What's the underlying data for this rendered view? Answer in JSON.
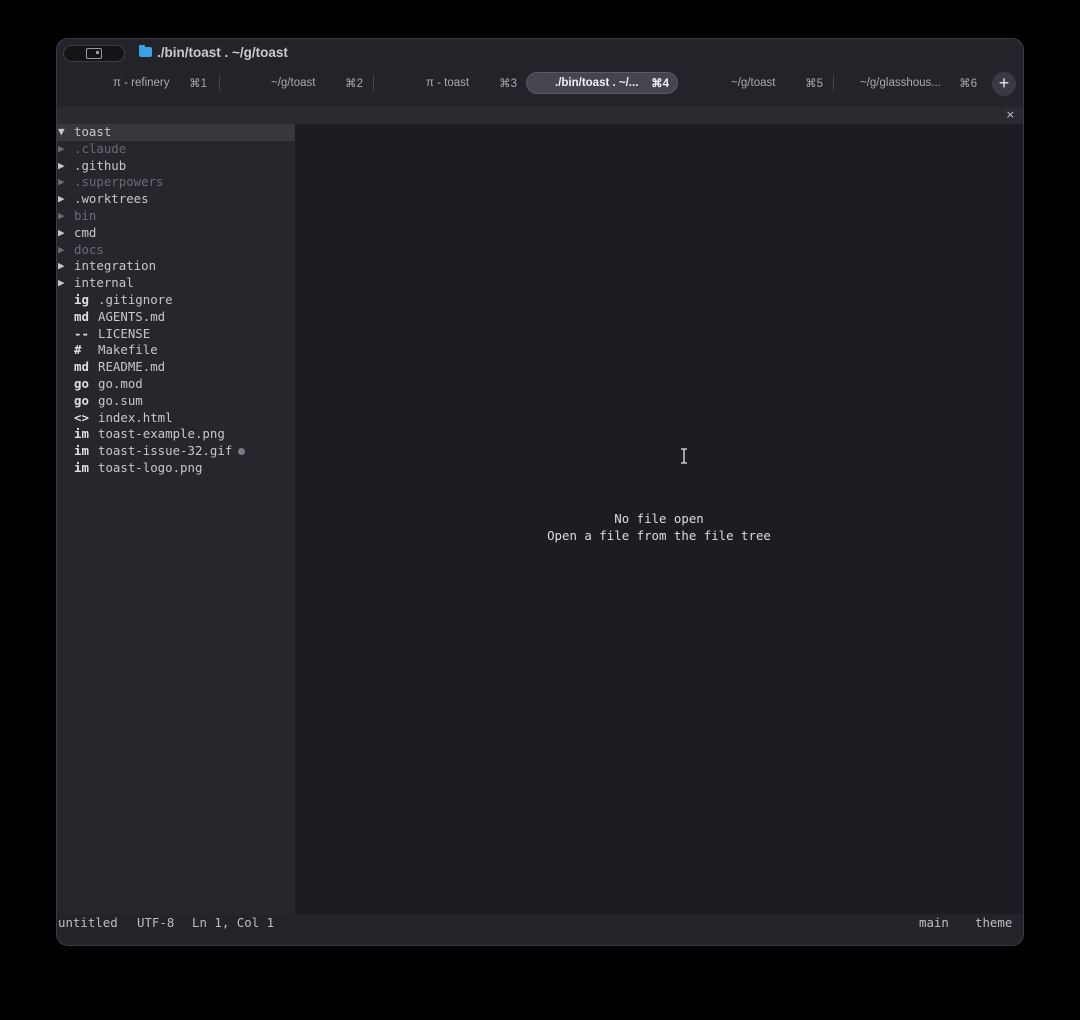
{
  "window": {
    "title": "./bin/toast . ~/g/toast"
  },
  "tabs": [
    {
      "label": "π - refinery",
      "shortcut": "⌘1"
    },
    {
      "label": "~/g/toast",
      "shortcut": "⌘2"
    },
    {
      "label": "π - toast",
      "shortcut": "⌘3"
    },
    {
      "label": "./bin/toast . ~/...",
      "shortcut": "⌘4",
      "active": true
    },
    {
      "label": "~/g/toast",
      "shortcut": "⌘5"
    },
    {
      "label": "~/g/glasshous...",
      "shortcut": "⌘6"
    }
  ],
  "new_tab_label": "+",
  "close_label": "×",
  "tree": {
    "root": {
      "arrow": "▼",
      "name": "toast"
    },
    "folders": [
      {
        "arrow": "▶",
        "name": ".claude",
        "dim": true
      },
      {
        "arrow": "▶",
        "name": ".github",
        "dim": false
      },
      {
        "arrow": "▶",
        "name": ".superpowers",
        "dim": true
      },
      {
        "arrow": "▶",
        "name": ".worktrees",
        "dim": false
      },
      {
        "arrow": "▶",
        "name": "bin",
        "dim": true
      },
      {
        "arrow": "▶",
        "name": "cmd",
        "dim": false
      },
      {
        "arrow": "▶",
        "name": "docs",
        "dim": true
      },
      {
        "arrow": "▶",
        "name": "integration",
        "dim": false
      },
      {
        "arrow": "▶",
        "name": "internal",
        "dim": false
      }
    ],
    "files": [
      {
        "type": "ig",
        "name": ".gitignore"
      },
      {
        "type": "md",
        "name": "AGENTS.md"
      },
      {
        "type": "--",
        "name": "LICENSE"
      },
      {
        "type": "#",
        "name": "Makefile"
      },
      {
        "type": "md",
        "name": "README.md"
      },
      {
        "type": "go",
        "name": "go.mod"
      },
      {
        "type": "go",
        "name": "go.sum"
      },
      {
        "type": "<>",
        "name": "index.html"
      },
      {
        "type": "im",
        "name": "toast-example.png"
      },
      {
        "type": "im",
        "name": "toast-issue-32.gif",
        "modified": true
      },
      {
        "type": "im",
        "name": "toast-logo.png"
      }
    ]
  },
  "editor": {
    "empty_title": "No file open",
    "empty_subtitle": "Open a file from the file tree"
  },
  "status": {
    "filename": "untitled",
    "encoding": "UTF-8",
    "position": "Ln 1, Col 1",
    "branch": "main",
    "theme": "theme"
  },
  "colors": {
    "window_bg": "#232329",
    "editor_bg": "#1c1c22",
    "tree_bg": "#26262c",
    "folder_icon": "#3aa0e8",
    "active_tab_bg": "#45454d"
  }
}
